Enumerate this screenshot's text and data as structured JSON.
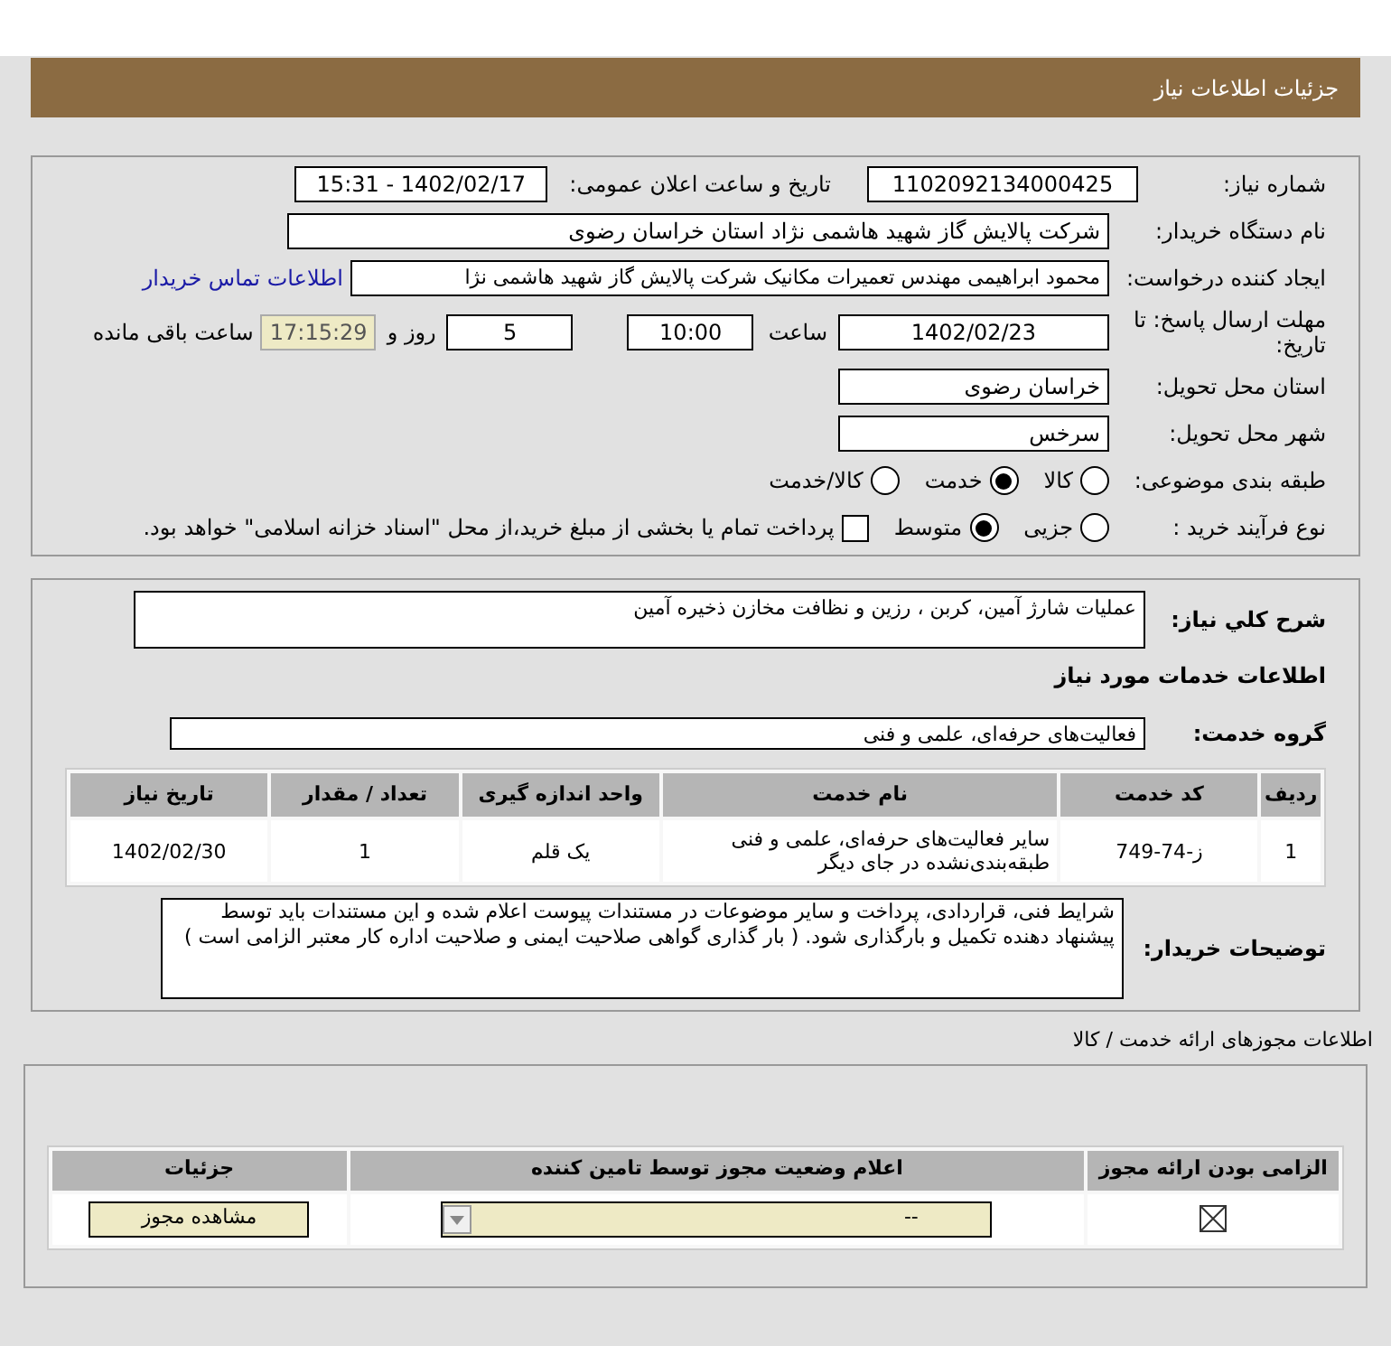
{
  "header": {
    "title": "جزئیات اطلاعات نیاز"
  },
  "details": {
    "need_number_label": "شماره نیاز:",
    "need_number": "1102092134000425",
    "announce_label": "تاریخ و ساعت اعلان عمومی:",
    "announce_value": "1402/02/17 - 15:31",
    "buyer_label": "نام دستگاه خریدار:",
    "buyer": "شرکت پالایش گاز شهید هاشمی نژاد   استان خراسان رضوی",
    "creator_label": "ایجاد کننده درخواست:",
    "creator": "محمود ابراهیمی مهندس تعمیرات مکانیک شرکت پالایش گاز شهید هاشمی نژا",
    "contact_link": "اطلاعات تماس خریدار",
    "deadline_label": "مهلت ارسال پاسخ: تا تاریخ:",
    "deadline_date": "1402/02/23",
    "time_label": "ساعت",
    "deadline_time": "10:00",
    "days": "5",
    "days_label": "روز و",
    "remaining": "17:15:29",
    "remaining_label": "ساعت باقی مانده",
    "province_label": "استان محل تحویل:",
    "province": "خراسان رضوی",
    "city_label": "شهر محل تحویل:",
    "city": "سرخس",
    "category_label": "طبقه بندی موضوعی:",
    "category_options": [
      {
        "label": "کالا",
        "selected": false
      },
      {
        "label": "خدمت",
        "selected": true
      },
      {
        "label": "کالا/خدمت",
        "selected": false
      }
    ],
    "process_label": "نوع فرآیند خرید :",
    "process_options": [
      {
        "label": "جزیی",
        "selected": false
      },
      {
        "label": "متوسط",
        "selected": true
      }
    ],
    "payment_checkbox": {
      "label": "پرداخت تمام یا بخشی از مبلغ خرید،از محل \"اسناد خزانه اسلامی\" خواهد بود.",
      "checked": false
    }
  },
  "need": {
    "summary_label": "شرح کلي نياز:",
    "summary": "عملیات شارژ آمین، کربن ، رزین و نظافت مخازن ذخیره آمین",
    "services_heading": "اطلاعات خدمات مورد نیاز",
    "group_label": "گروه خدمت:",
    "group": "فعالیت‌های حرفه‌ای، علمی و فنی",
    "table": {
      "columns": [
        "ردیف",
        "کد خدمت",
        "نام خدمت",
        "واحد اندازه گیری",
        "تعداد / مقدار",
        "تاریخ نیاز"
      ],
      "rows": [
        [
          "1",
          "ز-74-749",
          "سایر فعالیت‌های حرفه‌ای، علمی و فنی طبقه‌بندی‌نشده در جای دیگر",
          "یک قلم",
          "1",
          "1402/02/30"
        ]
      ]
    },
    "notes_label": "توضیحات خریدار:",
    "notes": "شرایط فنی، قراردادی، پرداخت و سایر موضوعات در مستندات پیوست اعلام شده و این مستندات باید توسط پیشنهاد دهنده تکمیل و  بارگذاری شود. ( بار گذاری گواهی صلاحیت ایمنی و صلاحیت اداره کار معتبر الزامی است )"
  },
  "permits": {
    "heading": "اطلاعات مجوزهای ارائه خدمت / کالا",
    "columns": [
      "الزامی بودن ارائه مجوز",
      "اعلام وضعیت مجوز توسط تامین کننده",
      "جزئیات"
    ],
    "rows": [
      {
        "required": true,
        "status": "--",
        "button": "مشاهده مجوز"
      }
    ]
  }
}
